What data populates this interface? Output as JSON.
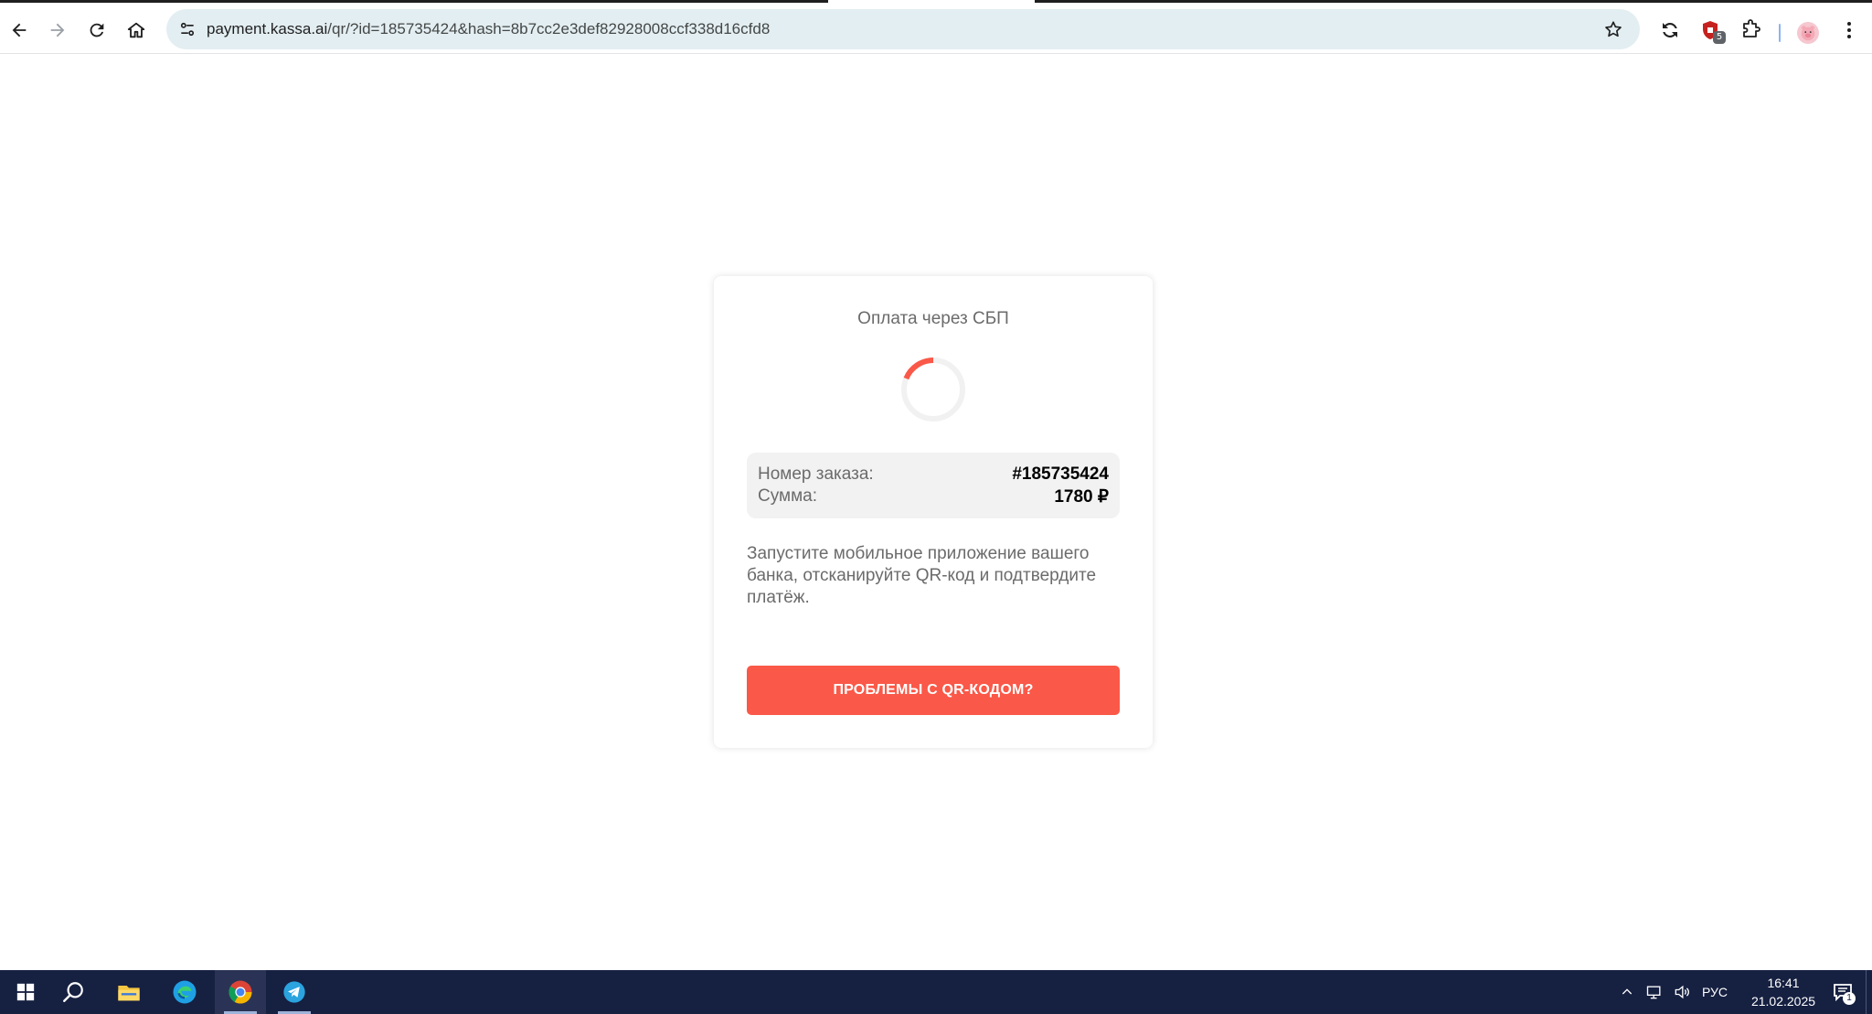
{
  "browser": {
    "url_host": "payment.kassa.ai",
    "url_path": "/qr/?id=185735424&hash=8b7cc2e3def82928008ccf338d16cfd8",
    "extension_badge": "5"
  },
  "page": {
    "title": "Оплата через СБП",
    "order_label": "Номер заказа:",
    "order_value": "#185735424",
    "sum_label": "Сумма:",
    "sum_value": "1780 ₽",
    "instructions": "Запустите мобильное приложение вашего банка, отсканируйте QR-код и подтвердите платёж.",
    "problem_button": "ПРОБЛЕМЫ С QR-КОДОМ?",
    "accent_color": "#fa5848"
  },
  "taskbar": {
    "language": "РУС",
    "time": "16:41",
    "date": "21.02.2025",
    "notification_count": "1",
    "apps": [
      "start-icon",
      "search-icon",
      "file-explorer-icon",
      "edge-icon",
      "chrome-icon",
      "telegram-icon"
    ]
  }
}
